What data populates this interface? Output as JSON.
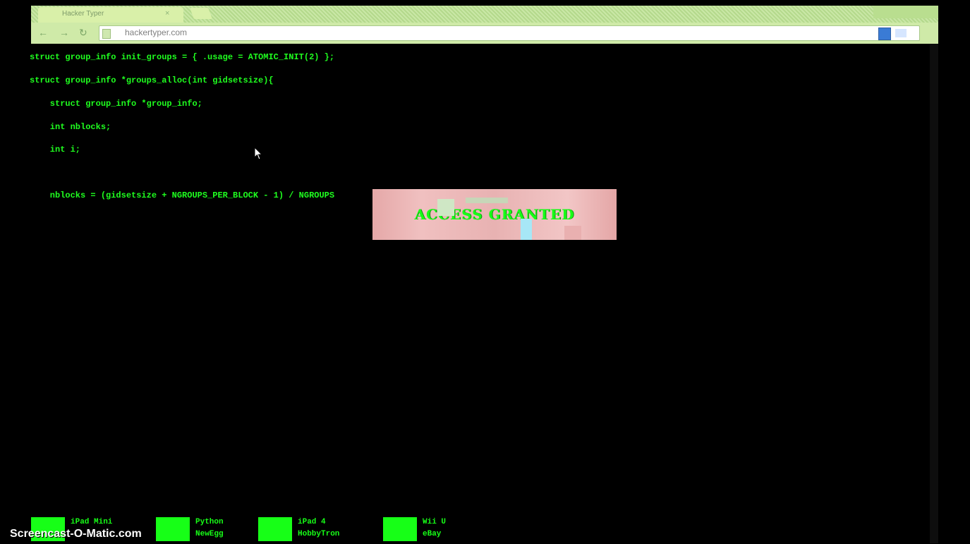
{
  "browser": {
    "tab_title": "Hacker Typer",
    "tab_close": "×",
    "url": "hackertyper.com",
    "nav": {
      "back": "←",
      "forward": "→",
      "reload": "↻"
    }
  },
  "code_lines": [
    "struct group_info init_groups = { .usage = ATOMIC_INIT(2) };",
    "struct group_info *groups_alloc(int gidsetsize){",
    "    struct group_info *group_info;",
    "    int nblocks;",
    "    int i;",
    "",
    "    nblocks = (gidsetsize + NGROUPS_PER_BLOCK - 1) / NGROUPS"
  ],
  "access_banner": "ACCESS GRANTED",
  "links": [
    {
      "line1": "iPad Mini",
      "line2": ""
    },
    {
      "line1": "Python",
      "line2": "NewEgg"
    },
    {
      "line1": "iPad 4",
      "line2": "HobbyTron"
    },
    {
      "line1": "Wii U",
      "line2": "eBay"
    }
  ],
  "watermark": "Screencast-O-Matic.com",
  "colors": {
    "code": "#1fff1f",
    "background": "#000000",
    "banner": "#f0c0c0",
    "chrome": "#cfeaa8"
  }
}
